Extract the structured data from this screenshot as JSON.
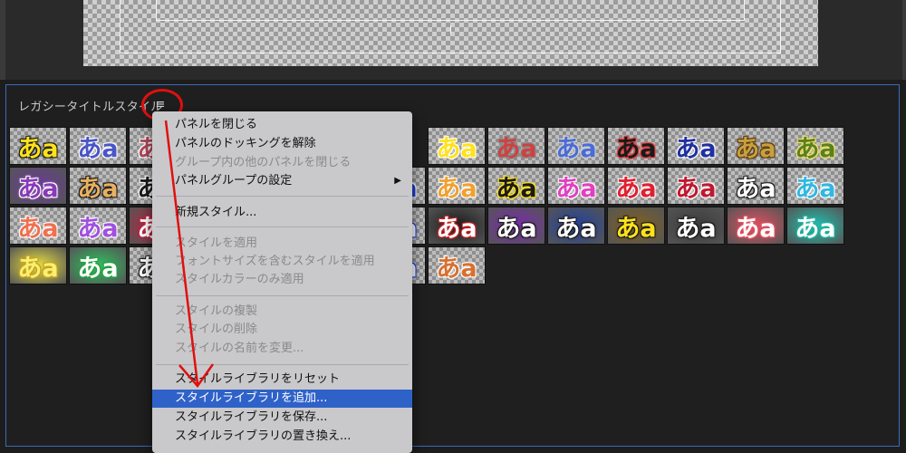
{
  "panel": {
    "title": "レガシータイトルスタイル",
    "menu_button_glyph": "≡"
  },
  "swatch_glyph": "あa",
  "swatch_rows": [
    [
      {
        "fg": "#ffe21a",
        "stroke": "#1a1a1a",
        "bg": ""
      },
      {
        "fg": "#4a55c8",
        "stroke": "#ffffff",
        "bg": ""
      },
      {
        "fg": "#b0485a",
        "stroke": "#ffffff",
        "bg": ""
      },
      {
        "fg": "",
        "stroke": "",
        "bg": ""
      },
      {
        "fg": "",
        "stroke": "",
        "bg": ""
      },
      {
        "fg": "",
        "stroke": "",
        "bg": ""
      },
      {
        "fg": "",
        "stroke": "",
        "bg": ""
      },
      {
        "fg": "#ffe21a",
        "stroke": "#ffffff",
        "bg": ""
      },
      {
        "fg": "#d04040",
        "stroke": "#8a8a8a",
        "bg": ""
      },
      {
        "fg": "#4a6cd8",
        "stroke": "#d0d0d0",
        "bg": ""
      },
      {
        "fg": "#1a1a1a",
        "stroke": "#e04040",
        "bg": ""
      },
      {
        "fg": "#2030a0",
        "stroke": "#ffffff",
        "bg": ""
      },
      {
        "fg": "#c8a040",
        "stroke": "#5a3a10",
        "bg": ""
      },
      {
        "fg": "#5a8020",
        "stroke": "#f0e070",
        "bg": ""
      }
    ],
    [
      {
        "fg": "#8a3ab8",
        "stroke": "#ffffff",
        "bg": "#6a3a9a"
      },
      {
        "fg": "#e8b060",
        "stroke": "#1a1a1a",
        "bg": ""
      },
      {
        "fg": "#1a1a1a",
        "stroke": "#ffffff",
        "bg": ""
      },
      {
        "fg": "",
        "stroke": "",
        "bg": ""
      },
      {
        "fg": "",
        "stroke": "",
        "bg": ""
      },
      {
        "fg": "",
        "stroke": "",
        "bg": ""
      },
      {
        "fg": "#2040d0",
        "stroke": "#ffffff",
        "bg": ""
      },
      {
        "fg": "#f0a030",
        "stroke": "#ffffff",
        "bg": ""
      },
      {
        "fg": "#1a1a1a",
        "stroke": "#ffe21a",
        "bg": ""
      },
      {
        "fg": "#e040c0",
        "stroke": "#ffffff",
        "bg": ""
      },
      {
        "fg": "#e02030",
        "stroke": "#ffffff",
        "bg": ""
      },
      {
        "fg": "#c01830",
        "stroke": "#ffffff",
        "bg": ""
      },
      {
        "fg": "#ffffff",
        "stroke": "#1a1a1a",
        "bg": ""
      },
      {
        "fg": "#30b8e0",
        "stroke": "#ffffff",
        "bg": ""
      }
    ],
    [
      {
        "fg": "#f07050",
        "stroke": "#ffffff",
        "bg": ""
      },
      {
        "fg": "#a050e0",
        "stroke": "#ffffff",
        "bg": ""
      },
      {
        "fg": "#ffffff",
        "stroke": "#c02040",
        "bg": "#c02040"
      },
      {
        "fg": "",
        "stroke": "",
        "bg": ""
      },
      {
        "fg": "",
        "stroke": "",
        "bg": ""
      },
      {
        "fg": "",
        "stroke": "",
        "bg": ""
      },
      {
        "fg": "#ffffff",
        "stroke": "#2040d0",
        "bg": ""
      },
      {
        "fg": "#ffffff",
        "stroke": "#c02020",
        "bg": "#1a1a1a"
      },
      {
        "fg": "#ffffff",
        "stroke": "#1a1a1a",
        "bg": "#7a2ab0"
      },
      {
        "fg": "#ffffff",
        "stroke": "#1a1a1a",
        "bg": "#2040a0"
      },
      {
        "fg": "#ffe21a",
        "stroke": "#1a1a1a",
        "bg": "#806020"
      },
      {
        "fg": "#ffffff",
        "stroke": "#1a1a1a",
        "bg": "#3a3a3a"
      },
      {
        "fg": "#ffffff",
        "stroke": "#e05060",
        "bg": "#e05060"
      },
      {
        "fg": "#ffffff",
        "stroke": "#20b0a0",
        "bg": "#20c0b0"
      }
    ],
    [
      {
        "fg": "#f8f070",
        "stroke": "#c8a020",
        "bg": "#e8e040"
      },
      {
        "fg": "#ffffff",
        "stroke": "#20a040",
        "bg": "#30c060"
      },
      {
        "fg": "#ffffff",
        "stroke": "#1a1a1a",
        "bg": ""
      },
      {
        "fg": "",
        "stroke": "",
        "bg": ""
      },
      {
        "fg": "",
        "stroke": "",
        "bg": ""
      },
      {
        "fg": "",
        "stroke": "",
        "bg": ""
      },
      {
        "fg": "#ffffff",
        "stroke": "#2040d0",
        "bg": ""
      },
      {
        "fg": "#d87030",
        "stroke": "#ffffff",
        "bg": ""
      }
    ]
  ],
  "context_menu": {
    "items": [
      {
        "label": "パネルを閉じる",
        "state": "enabled"
      },
      {
        "label": "パネルのドッキングを解除",
        "state": "enabled"
      },
      {
        "label": "グループ内の他のパネルを閉じる",
        "state": "disabled"
      },
      {
        "label": "パネルグループの設定",
        "state": "enabled",
        "submenu": true
      },
      {
        "label": "新規スタイル...",
        "state": "enabled"
      },
      {
        "label": "スタイルを適用",
        "state": "disabled"
      },
      {
        "label": "フォントサイズを含むスタイルを適用",
        "state": "disabled"
      },
      {
        "label": "スタイルカラーのみ適用",
        "state": "disabled"
      },
      {
        "label": "スタイルの複製",
        "state": "disabled"
      },
      {
        "label": "スタイルの削除",
        "state": "disabled"
      },
      {
        "label": "スタイルの名前を変更...",
        "state": "disabled"
      },
      {
        "label": "スタイルライブラリをリセット",
        "state": "enabled"
      },
      {
        "label": "スタイルライブラリを追加...",
        "state": "selected"
      },
      {
        "label": "スタイルライブラリを保存...",
        "state": "enabled"
      },
      {
        "label": "スタイルライブラリの置き換え...",
        "state": "enabled"
      }
    ],
    "submenu_glyph": "▶"
  },
  "colors": {
    "selection": "#2f62c9",
    "annotation": "#e01010",
    "panel_border": "#3d6bb8"
  }
}
